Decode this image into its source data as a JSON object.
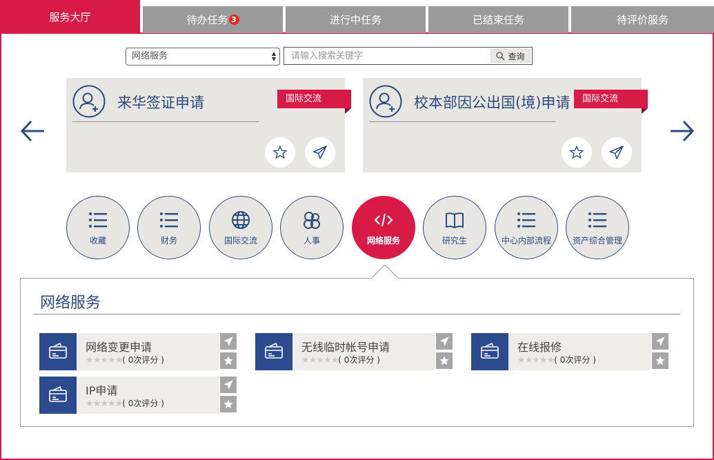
{
  "tabs": [
    {
      "label": "服务大厅",
      "active": true
    },
    {
      "label": "待办任务",
      "badge": "3"
    },
    {
      "label": "进行中任务"
    },
    {
      "label": "已结束任务"
    },
    {
      "label": "待评价服务"
    }
  ],
  "search": {
    "select_value": "网络服务",
    "placeholder": "请输入搜索关键字",
    "button_label": "查询"
  },
  "featured": [
    {
      "title": "来华签证申请",
      "tag": "国际交流"
    },
    {
      "title": "校本部因公出国(境)申请",
      "tag": "国际交流"
    }
  ],
  "categories": [
    {
      "label": "收藏",
      "icon": "list-icon"
    },
    {
      "label": "财务",
      "icon": "list-icon"
    },
    {
      "label": "国际交流",
      "icon": "globe-icon"
    },
    {
      "label": "人事",
      "icon": "people-icon"
    },
    {
      "label": "网络服务",
      "icon": "code-icon",
      "active": true
    },
    {
      "label": "研究生",
      "icon": "book-icon"
    },
    {
      "label": "中心内部流程",
      "icon": "list-icon"
    },
    {
      "label": "资产综合管理",
      "icon": "list-icon"
    }
  ],
  "section": {
    "title": "网络服务",
    "items": [
      {
        "name": "网络变更申请",
        "rating": "( 0次评分 )"
      },
      {
        "name": "无线临时帐号申请",
        "rating": "( 0次评分 )"
      },
      {
        "name": "在线报修",
        "rating": "( 0次评分 )"
      },
      {
        "name": "IP申请",
        "rating": "( 0次评分 )"
      }
    ],
    "stars": "★★★★★"
  },
  "colors": {
    "accent": "#d81b46",
    "navy": "#2d4a7c",
    "tab_gray": "#9b9b9b",
    "card_bg": "#e8e6e2"
  }
}
